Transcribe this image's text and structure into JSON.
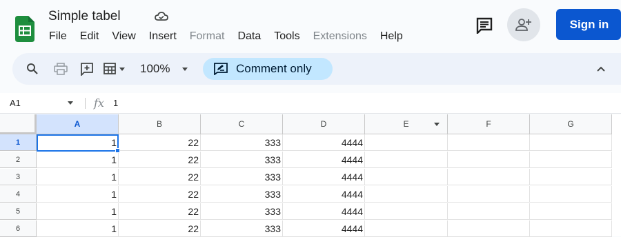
{
  "header": {
    "title": "Simple tabel",
    "menu": [
      {
        "label": "File",
        "dim": false
      },
      {
        "label": "Edit",
        "dim": false
      },
      {
        "label": "View",
        "dim": false
      },
      {
        "label": "Insert",
        "dim": false
      },
      {
        "label": "Format",
        "dim": true
      },
      {
        "label": "Data",
        "dim": false
      },
      {
        "label": "Tools",
        "dim": false
      },
      {
        "label": "Extensions",
        "dim": true
      },
      {
        "label": "Help",
        "dim": false
      }
    ],
    "sign_in_label": "Sign in"
  },
  "toolbar": {
    "zoom": "100%",
    "comment_only_label": "Comment only"
  },
  "formula_bar": {
    "cell_ref": "A1",
    "fx": "fx",
    "value": "1"
  },
  "grid": {
    "columns": [
      "A",
      "B",
      "C",
      "D",
      "E",
      "F",
      "G"
    ],
    "rows": [
      {
        "num": "1",
        "cells": [
          "1",
          "22",
          "333",
          "4444",
          "",
          "",
          ""
        ]
      },
      {
        "num": "2",
        "cells": [
          "1",
          "22",
          "333",
          "4444",
          "",
          "",
          ""
        ]
      },
      {
        "num": "3",
        "cells": [
          "1",
          "22",
          "333",
          "4444",
          "",
          "",
          ""
        ]
      },
      {
        "num": "4",
        "cells": [
          "1",
          "22",
          "333",
          "4444",
          "",
          "",
          ""
        ]
      },
      {
        "num": "5",
        "cells": [
          "1",
          "22",
          "333",
          "4444",
          "",
          "",
          ""
        ]
      },
      {
        "num": "6",
        "cells": [
          "1",
          "22",
          "333",
          "4444",
          "",
          "",
          ""
        ]
      }
    ]
  },
  "colors": {
    "accent": "#0b57d0",
    "chip": "#c2e7ff",
    "toolbar_bg": "#edf2fa",
    "selection": "#1a73e8",
    "app_logo": "#1e8e3e"
  },
  "icons": [
    "sheets-logo-icon",
    "cloud-icon",
    "comment-history-icon",
    "add-person-icon",
    "search-icon",
    "print-icon",
    "add-comment-icon",
    "table-format-icon",
    "chevron-down-icon",
    "comment-only-icon",
    "chevron-up-icon",
    "fx-icon"
  ]
}
